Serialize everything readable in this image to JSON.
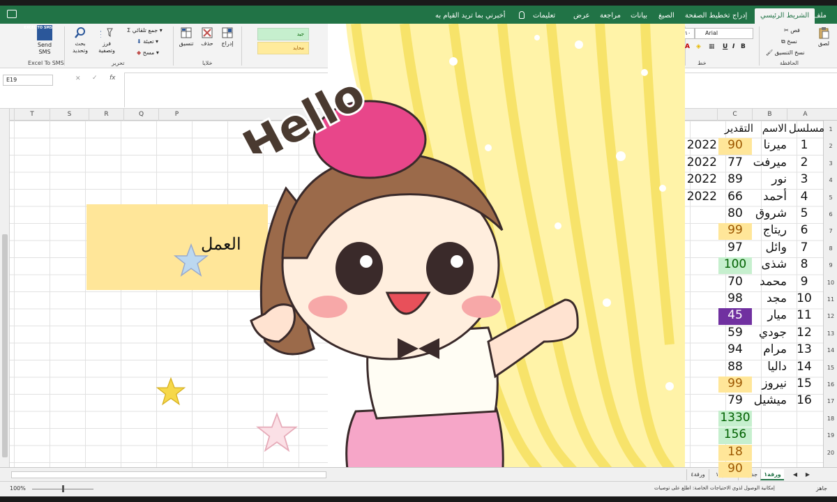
{
  "titlebar": {
    "tabs": [
      "ملف",
      "الشريط الرئيسي",
      "إدراج",
      "تخطيط الصفحة",
      "الصيغ",
      "بيانات",
      "مراجعة",
      "عرض",
      "تعليمات"
    ],
    "active_tab": "الشريط الرئيسي",
    "tell_me": "أخبرني بما تريد القيام به"
  },
  "ribbon": {
    "clipboard": {
      "paste": "لصق",
      "cut": "قص",
      "copy": "نسخ",
      "format_painter": "نسخ التنسيق",
      "group": "الحافظة"
    },
    "font": {
      "name": "Arial",
      "size": "١٠",
      "group": "خط",
      "bold": "B",
      "italic": "I",
      "underline": "U"
    },
    "styles": {
      "good": "جيد",
      "neutral": "محايد"
    },
    "cells": {
      "insert": "إدراج",
      "delete": "حذف",
      "format": "تنسيق",
      "group": "خلايا"
    },
    "editing": {
      "autosum": "جمع تلقائي",
      "fill": "تعبئة",
      "clear": "مسح",
      "sort": "فرز وتصفية",
      "find": "بحث وتحديد",
      "group": "تحرير"
    },
    "sms": {
      "icon_text": "EXCEL TO SMS",
      "label": "Send SMS",
      "group": "Excel To SMS"
    }
  },
  "formula_bar": {
    "name_box": "E19",
    "cancel": "✕",
    "enter": "✓",
    "fx": "fx",
    "value": ""
  },
  "columns_left": [
    "T",
    "S",
    "R",
    "Q",
    "P"
  ],
  "columns_right": [
    "C",
    "B",
    "A"
  ],
  "worksheet": {
    "header_serial": "مسلسل",
    "header_name": "الاسم",
    "header_grade": "التقدير",
    "rows": [
      {
        "serial": "1",
        "name": "ميرنا",
        "grade": "90",
        "year": "2022",
        "bg": "#ffe699"
      },
      {
        "serial": "2",
        "name": "ميرفت",
        "grade": "77",
        "year": "2022",
        "bg": ""
      },
      {
        "serial": "3",
        "name": "نور",
        "grade": "89",
        "year": "2022",
        "bg": ""
      },
      {
        "serial": "4",
        "name": "أحمد",
        "grade": "66",
        "year": "2022",
        "bg": ""
      },
      {
        "serial": "5",
        "name": "شروق",
        "grade": "80",
        "year": "",
        "bg": ""
      },
      {
        "serial": "6",
        "name": "ريتاج",
        "grade": "99",
        "year": "",
        "bg": "#ffe699"
      },
      {
        "serial": "7",
        "name": "وائل",
        "grade": "97",
        "year": "",
        "bg": ""
      },
      {
        "serial": "8",
        "name": "شذى",
        "grade": "100",
        "year": "",
        "bg": "#c6efce"
      },
      {
        "serial": "9",
        "name": "محمد",
        "grade": "70",
        "year": "",
        "bg": ""
      },
      {
        "serial": "10",
        "name": "مجد",
        "grade": "98",
        "year": "",
        "bg": ""
      },
      {
        "serial": "11",
        "name": "ميار",
        "grade": "45",
        "year": "",
        "bg": "#7030a0"
      },
      {
        "serial": "12",
        "name": "جودي",
        "grade": "59",
        "year": "",
        "bg": ""
      },
      {
        "serial": "13",
        "name": "مرام",
        "grade": "94",
        "year": "",
        "bg": ""
      },
      {
        "serial": "14",
        "name": "داليا",
        "grade": "88",
        "year": "",
        "bg": ""
      },
      {
        "serial": "15",
        "name": "نيروز",
        "grade": "99",
        "year": "",
        "bg": "#ffe699"
      },
      {
        "serial": "16",
        "name": "ميشيل",
        "grade": "79",
        "year": "",
        "bg": ""
      }
    ],
    "totals": [
      {
        "value": "1330",
        "bg": "#c6efce"
      },
      {
        "value": "156",
        "bg": "#c6efce"
      },
      {
        "value": "18",
        "bg": "#ffe699"
      },
      {
        "value": "90",
        "bg": "#ffe699"
      }
    ],
    "row_numbers": [
      "1",
      "2",
      "3",
      "4",
      "5",
      "6",
      "7",
      "8",
      "9",
      "10",
      "11",
      "12",
      "13",
      "14",
      "15",
      "16",
      "17",
      "18",
      "19",
      "20"
    ],
    "side_text": "العمل"
  },
  "sticker": {
    "text": "Hello"
  },
  "sheet_tabs": [
    "ورقة١",
    "جدول٢",
    "جدول١",
    "ورقة٤"
  ],
  "active_sheet": "ورقة١",
  "status": {
    "ready": "جاهز",
    "accessibility": "إمكانية الوصول لذوي الاحتياجات الخاصة: اطلع على توصيات",
    "zoom": "100%",
    "zoom_level": 0.5
  },
  "colors": {
    "excel_green": "#217346",
    "good_fill": "#c6efce",
    "neutral_fill": "#ffe699",
    "purple_fill": "#7030a0"
  }
}
